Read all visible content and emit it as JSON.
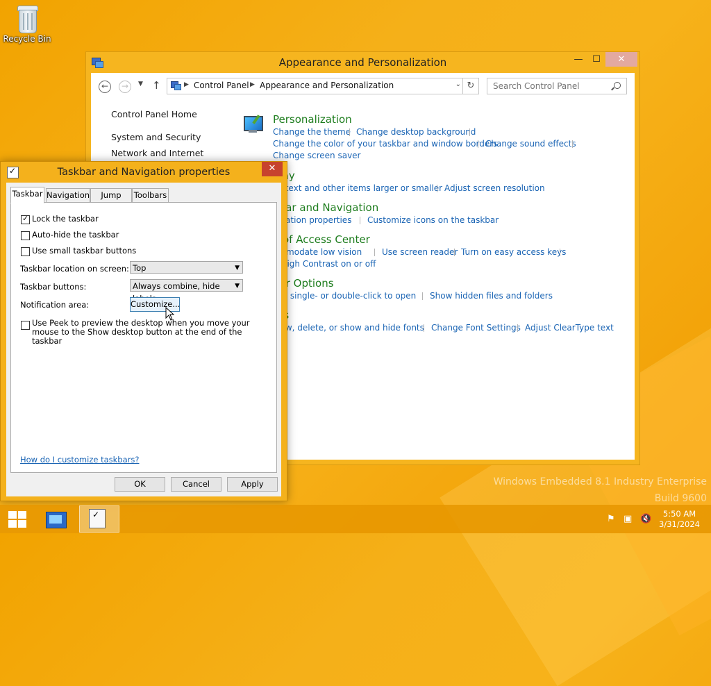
{
  "desktop": {
    "recycle_bin_label": "Recycle Bin",
    "watermark_line1": "Windows Embedded 8.1 Industry Enterprise",
    "watermark_line2": "Build 9600"
  },
  "control_panel": {
    "title": "Appearance and Personalization",
    "controls": {
      "minimize": "—",
      "maximize": "☐",
      "close": "✕"
    },
    "breadcrumb": [
      "Control Panel",
      "Appearance and Personalization"
    ],
    "search_placeholder": "Search Control Panel",
    "sidebar": [
      "Control Panel Home",
      "System and Security",
      "Network and Internet"
    ],
    "sections": [
      {
        "title": "Personalization",
        "links": [
          "Change the theme",
          "Change desktop background",
          "Change the color of your taskbar and window borders",
          "Change sound effects",
          "Change screen saver"
        ]
      },
      {
        "title": "play",
        "links": [
          "ke text and other items larger or smaller",
          "Adjust screen resolution"
        ]
      },
      {
        "title": "kbar and Navigation",
        "links": [
          "vigation properties",
          "Customize icons on the taskbar"
        ]
      },
      {
        "title": "e of Access Center",
        "links": [
          "ommodate low vision",
          "Use screen reader",
          "Turn on easy access keys",
          "n High Contrast on or off"
        ]
      },
      {
        "title": "der Options",
        "links": [
          "cify single- or double-click to open",
          "Show hidden files and folders"
        ]
      },
      {
        "title": "nts",
        "links": [
          "view, delete, or show and hide fonts",
          "Change Font Settings",
          "Adjust ClearType text"
        ]
      }
    ]
  },
  "dialog": {
    "title": "Taskbar and Navigation properties",
    "close": "✕",
    "tabs": [
      "Taskbar",
      "Navigation",
      "Jump Lists",
      "Toolbars"
    ],
    "checkboxes": [
      {
        "label": "Lock the taskbar",
        "checked": true
      },
      {
        "label": "Auto-hide the taskbar",
        "checked": false
      },
      {
        "label": "Use small taskbar buttons",
        "checked": false
      }
    ],
    "location_label": "Taskbar location on screen:",
    "location_value": "Top",
    "buttons_label": "Taskbar buttons:",
    "buttons_value": "Always combine, hide labels",
    "notification_label": "Notification area:",
    "customize_button": "Customize...",
    "peek_label": "Use Peek to preview the desktop when you move your mouse to the Show desktop button at the end of the taskbar",
    "peek_checked": false,
    "help_link": "How do I customize taskbars?",
    "ok": "OK",
    "cancel": "Cancel",
    "apply": "Apply"
  },
  "taskbar": {
    "time": "5:50 AM",
    "date": "3/31/2024"
  }
}
